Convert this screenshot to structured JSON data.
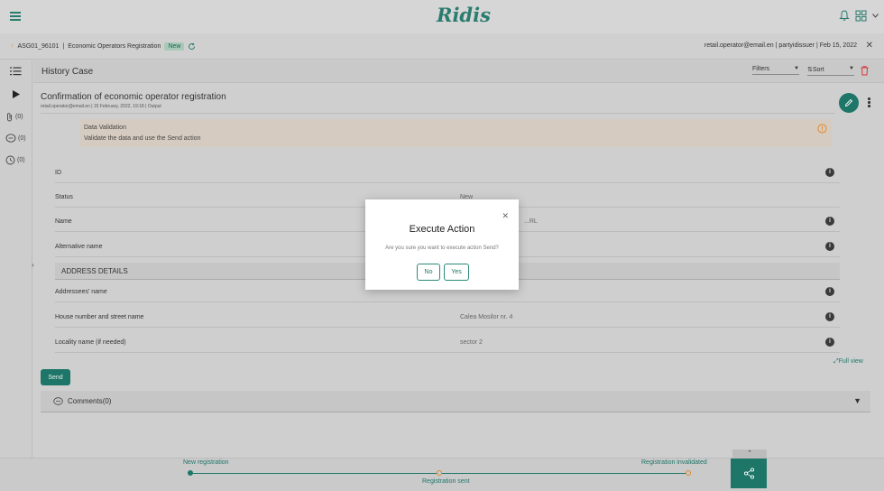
{
  "app": {
    "logo": "Ridis"
  },
  "caseBar": {
    "caseId": "ASG01_96101",
    "separator": "|",
    "caseType": "Economic Operators Registration",
    "status": "New",
    "userInfo": "retail.operator@email.en | partyidissuer | Feb 15, 2022"
  },
  "sidebar": {
    "attachments_count": "(0)",
    "messages_count": "(0)",
    "history_count": "(0)"
  },
  "history": {
    "title": "History Case",
    "filters_label": "Filters",
    "sort_label": "Sort"
  },
  "document": {
    "title": "Confirmation of economic operator registration",
    "subtitle": "retail.operator@email.en | 15 February, 2022, 19:18 | Output"
  },
  "alert": {
    "title": "Data Validation",
    "message": "Validate the data and use the Send action"
  },
  "fields": {
    "id": {
      "label": "ID",
      "value": ""
    },
    "status": {
      "label": "Status",
      "value": "New"
    },
    "name": {
      "label": "Name",
      "value": "...RL"
    },
    "alt_name": {
      "label": "Alternative name",
      "value": ""
    },
    "address_header": "ADDRESS DETAILS",
    "addressee": {
      "label": "Addressees' name",
      "value": ""
    },
    "street": {
      "label": "House number and street name",
      "value": "Calea Mosilor nr. 4"
    },
    "locality": {
      "label": "Locality name (if needed)",
      "value": "sector 2"
    }
  },
  "actions": {
    "full_view": "Full view",
    "send": "Send"
  },
  "comments": {
    "label": "Comments",
    "count": "(0)"
  },
  "timeline": {
    "step1": "New registration",
    "step2": "Registration sent",
    "step3": "Registration invalidated"
  },
  "modal": {
    "title": "Execute Action",
    "message": "Are you sure you want to execute action Send?",
    "no": "No",
    "yes": "Yes"
  },
  "colors": {
    "accent": "#1e7668",
    "warning": "#e08a2a",
    "danger": "#d33"
  }
}
